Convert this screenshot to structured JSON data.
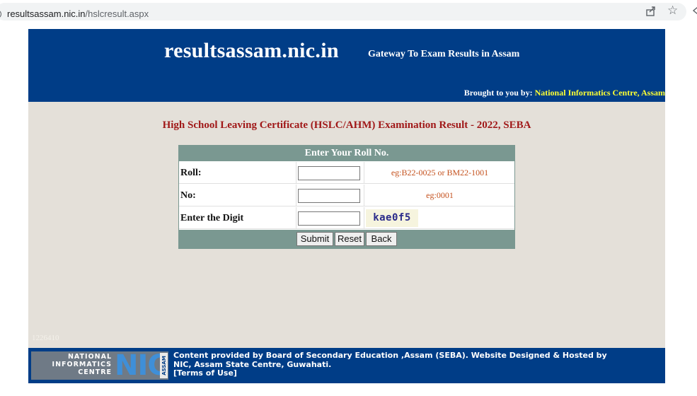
{
  "browser": {
    "url_host": "resultsassam.nic.in",
    "url_path": "/hslcresult.aspx"
  },
  "header": {
    "site_name": "resultsassam.nic.in",
    "tagline": "Gateway To Exam Results in Assam",
    "brought_by_label": "Brought to you by: ",
    "brought_by_org": "National Informatics Centre, Assam"
  },
  "exam_title": "High School Leaving Certificate (HSLC/AHM) Examination Result - 2022, SEBA",
  "form": {
    "heading": "Enter Your Roll No.",
    "roll_label": "Roll:",
    "roll_value": "",
    "roll_hint": "eg:B22-0025 or BM22-1001",
    "no_label": "No:",
    "no_value": "",
    "no_hint": "eg:0001",
    "digit_label": "Enter the Digit",
    "digit_value": "",
    "captcha": "kae0f5",
    "submit_label": "Submit",
    "reset_label": "Reset",
    "back_label": "Back"
  },
  "counter": "1226410",
  "footer": {
    "logo_text_1": "NATIONAL",
    "logo_text_2": "INFORMATICS",
    "logo_text_3": "CENTRE",
    "logo_mark": "NIC",
    "logo_side": "ASSAM",
    "line_1": "Content provided by Board of Secondary Education ,Assam (SEBA). Website Designed & Hosted by",
    "line_2": "NIC, Assam State Centre, Guwahati.",
    "line_3": "[Terms of Use]"
  },
  "colors": {
    "header_blue": "#003d87",
    "page_bg": "#e4e0d9",
    "title_red": "#a01818",
    "form_green": "#7a9891",
    "hint_orange": "#c4501c",
    "brought_yellow": "#ffff33"
  },
  "icons": [
    "info-icon",
    "share-icon",
    "star-icon",
    "edge-icon"
  ]
}
